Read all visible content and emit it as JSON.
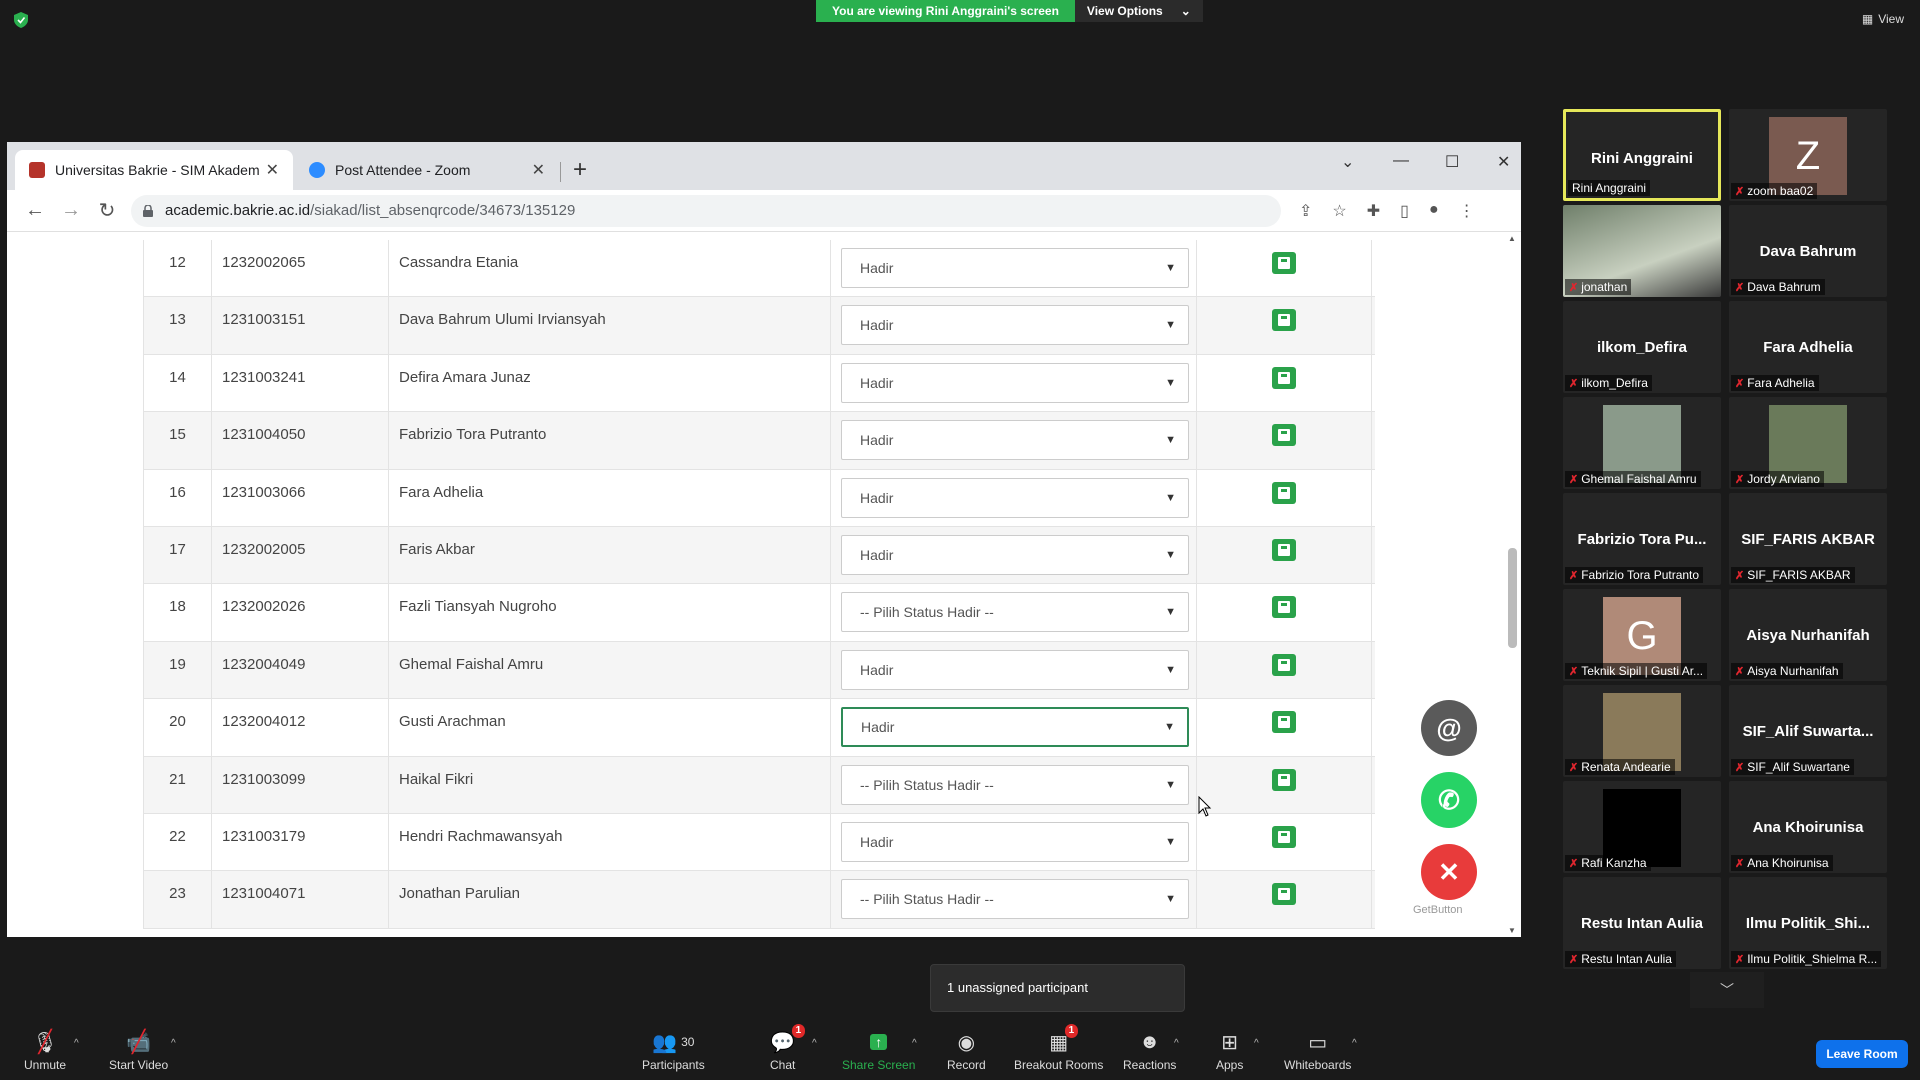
{
  "zoom": {
    "share_banner": "You are viewing Rini Anggraini's screen",
    "view_options": "View Options",
    "view": "View"
  },
  "browser": {
    "tabs": [
      {
        "title": "Universitas Bakrie - SIM Akademik",
        "active": true
      },
      {
        "title": "Post Attendee - Zoom",
        "active": false
      }
    ],
    "url_host": "academic.bakrie.ac.id",
    "url_path": "/siakad/list_absenqrcode/34673/135129"
  },
  "attendance": {
    "rows": [
      {
        "no": "12",
        "nim": "1232002065",
        "name": "Cassandra Etania",
        "status": "Hadir"
      },
      {
        "no": "13",
        "nim": "1231003151",
        "name": "Dava Bahrum Ulumi Irviansyah",
        "status": "Hadir"
      },
      {
        "no": "14",
        "nim": "1231003241",
        "name": "Defira Amara Junaz",
        "status": "Hadir"
      },
      {
        "no": "15",
        "nim": "1231004050",
        "name": "Fabrizio Tora Putranto",
        "status": "Hadir"
      },
      {
        "no": "16",
        "nim": "1231003066",
        "name": "Fara Adhelia",
        "status": "Hadir"
      },
      {
        "no": "17",
        "nim": "1232002005",
        "name": "Faris Akbar",
        "status": "Hadir"
      },
      {
        "no": "18",
        "nim": "1232002026",
        "name": "Fazli Tiansyah Nugroho",
        "status": "-- Pilih Status Hadir --"
      },
      {
        "no": "19",
        "nim": "1232004049",
        "name": "Ghemal Faishal Amru",
        "status": "Hadir"
      },
      {
        "no": "20",
        "nim": "1232004012",
        "name": "Gusti Arachman",
        "status": "Hadir"
      },
      {
        "no": "21",
        "nim": "1231003099",
        "name": "Haikal Fikri",
        "status": "-- Pilih Status Hadir --"
      },
      {
        "no": "22",
        "nim": "1231003179",
        "name": "Hendri Rachmawansyah",
        "status": "Hadir"
      },
      {
        "no": "23",
        "nim": "1231004071",
        "name": "Jonathan Parulian",
        "status": "-- Pilih Status Hadir --"
      }
    ],
    "getbutton": "GetButton"
  },
  "gallery": {
    "tiles": [
      {
        "display": "Rini Anggraini",
        "label": "Rini Anggraini",
        "kind": "name"
      },
      {
        "display": "Z",
        "label": "zoom baa02",
        "kind": "avatar",
        "color": "#7a5a50"
      },
      {
        "display": "",
        "label": "jonathan",
        "kind": "video",
        "color": "#6f7f6a"
      },
      {
        "display": "Dava Bahrum",
        "label": "Dava Bahrum",
        "kind": "name"
      },
      {
        "display": "ilkom_Defira",
        "label": "ilkom_Defira",
        "kind": "name"
      },
      {
        "display": "Fara Adhelia",
        "label": "Fara Adhelia",
        "kind": "name"
      },
      {
        "display": "",
        "label": "Ghemal Faishal Amru",
        "kind": "photo",
        "color": "#8a9a8a"
      },
      {
        "display": "",
        "label": "Jordy Arviano",
        "kind": "photo",
        "color": "#6a7a5a"
      },
      {
        "display": "Fabrizio Tora Pu...",
        "label": "Fabrizio Tora Putranto",
        "kind": "name"
      },
      {
        "display": "SIF_FARIS AKBAR",
        "label": "SIF_FARIS AKBAR",
        "kind": "name"
      },
      {
        "display": "G",
        "label": "Teknik Sipil | Gusti Ar...",
        "kind": "avatar",
        "color": "#b08a78"
      },
      {
        "display": "Aisya Nurhanifah",
        "label": "Aisya Nurhanifah",
        "kind": "name"
      },
      {
        "display": "",
        "label": "Renata Andearie",
        "kind": "photo",
        "color": "#8a7a5a"
      },
      {
        "display": "SIF_Alif Suwarta...",
        "label": "SIF_Alif Suwartane",
        "kind": "name"
      },
      {
        "display": "",
        "label": "Rafi Kanzha",
        "kind": "photo",
        "color": "#000000"
      },
      {
        "display": "Ana Khoirunisa",
        "label": "Ana Khoirunisa",
        "kind": "name"
      },
      {
        "display": "Restu Intan Aulia",
        "label": "Restu Intan Aulia",
        "kind": "name"
      },
      {
        "display": "Ilmu Politik_Shi...",
        "label": "Ilmu Politik_Shielma R...",
        "kind": "name"
      }
    ]
  },
  "notification": "1 unassigned participant",
  "toolbar": {
    "unmute": "Unmute",
    "start_video": "Start Video",
    "participants": "Participants",
    "participants_count": "30",
    "chat": "Chat",
    "chat_badge": "1",
    "share_screen": "Share Screen",
    "record": "Record",
    "breakout": "Breakout Rooms",
    "breakout_badge": "1",
    "reactions": "Reactions",
    "apps": "Apps",
    "whiteboards": "Whiteboards",
    "leave": "Leave Room"
  },
  "colors": {
    "zoom_green": "#2ab04f",
    "save_green": "#2aa24a",
    "leave_blue": "#0e71eb",
    "mute_red": "#e0262e"
  }
}
